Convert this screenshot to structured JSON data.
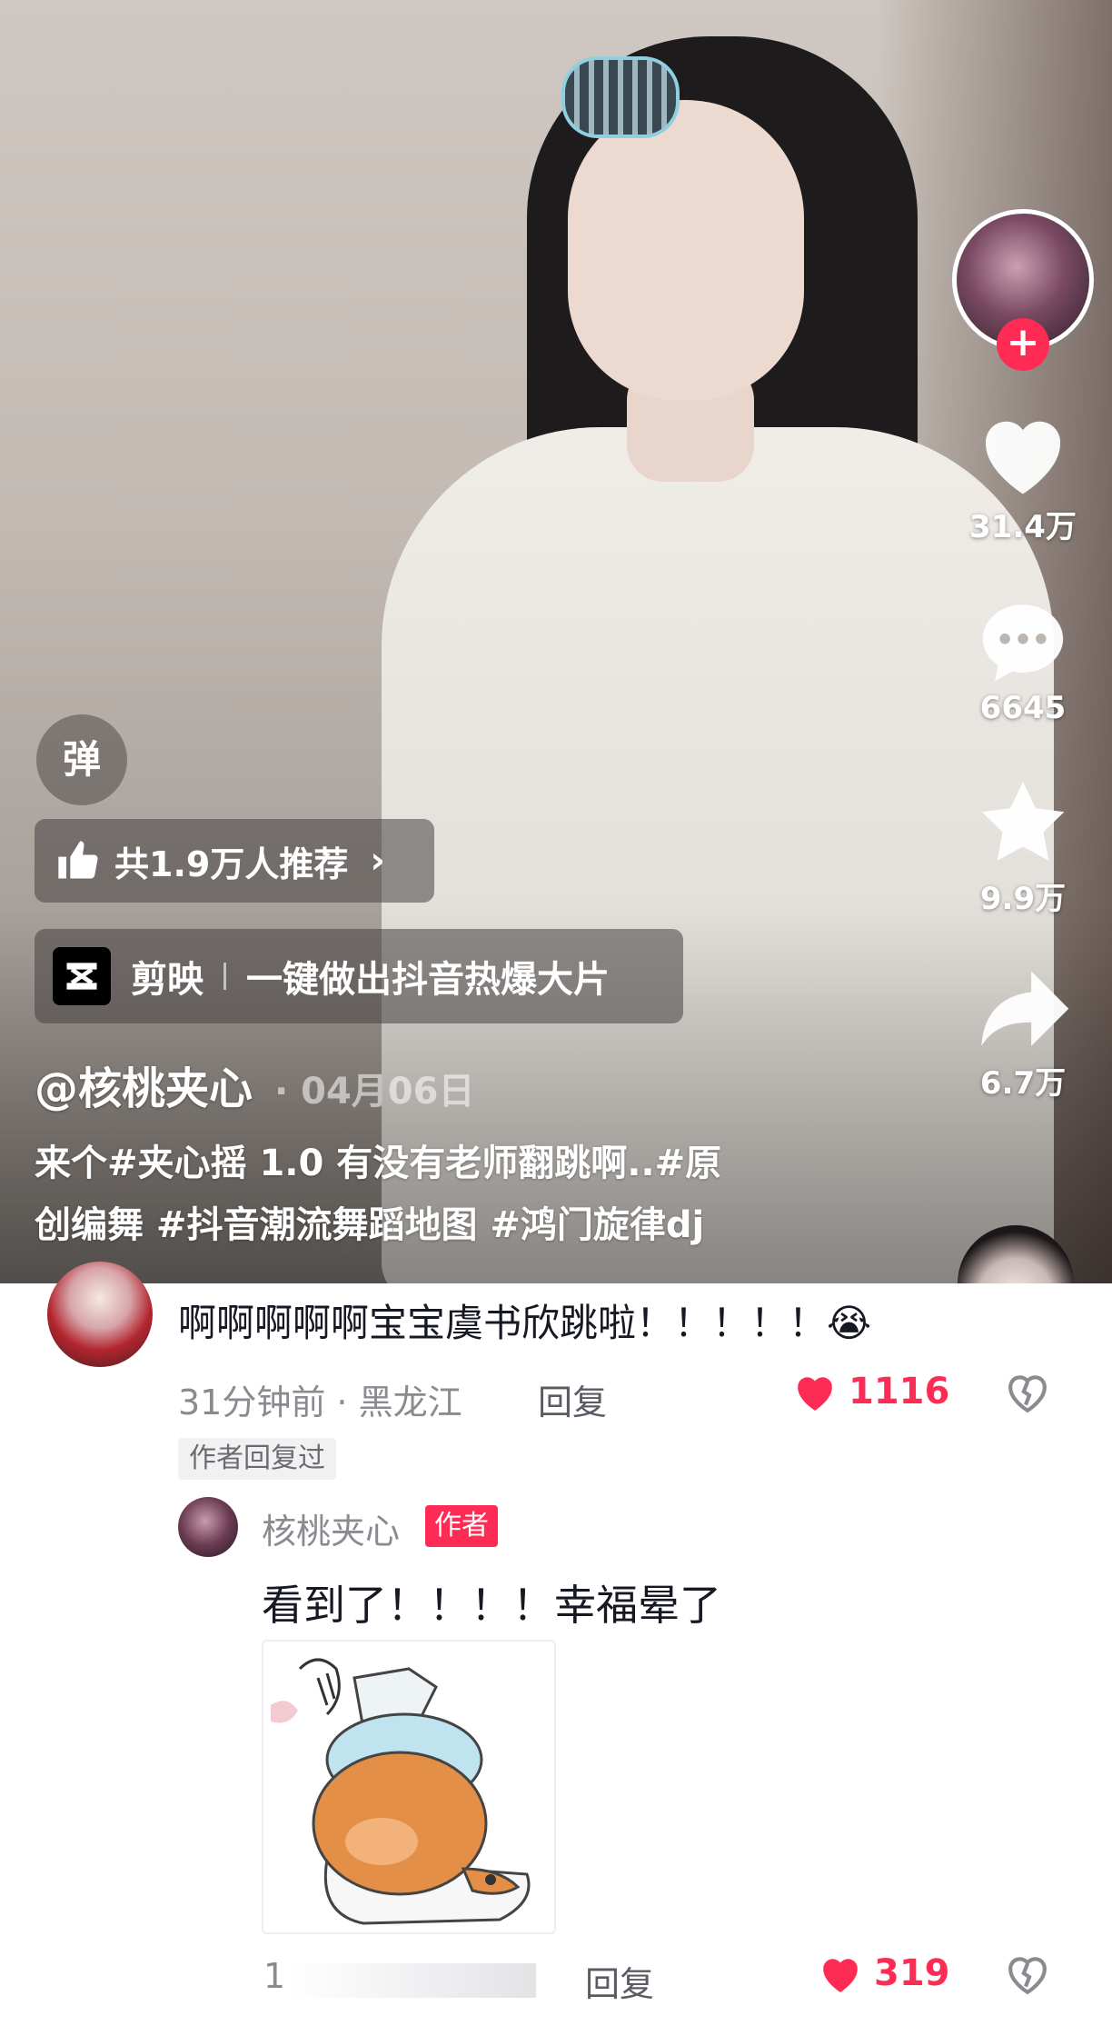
{
  "video": {
    "danmu_label": "弹",
    "recommend_label": "共1.9万人推荐",
    "recommend_chevron": "›",
    "ad": {
      "name": "剪映",
      "slogan": "一键做出抖音热爆大片"
    },
    "author": "@核桃夹心",
    "date": "· 04月06日",
    "caption_line1": "来个#夹心摇 1.0 有没有老师翻跳啊..#原",
    "caption_line2": "创编舞 #抖音潮流舞蹈地图 #鸿门旋律dj"
  },
  "rail": {
    "follow_symbol": "+",
    "likes": "31.4万",
    "comments": "6645",
    "favorites": "9.9万",
    "shares": "6.7万"
  },
  "comment": {
    "text": "啊啊啊啊啊宝宝虞书欣跳啦！！！！！😭",
    "meta": "31分钟前 · 黑龙江",
    "reply_label": "回复",
    "like_count": "1116",
    "author_replied_tag": "作者回复过",
    "reply": {
      "name": "核桃夹心",
      "badge": "作者",
      "text": "看到了！！！！幸福晕了",
      "time": "1",
      "reply_label": "回复",
      "like_count": "319"
    }
  },
  "colors": {
    "accent": "#fe2c55",
    "text_primary": "#161823",
    "text_secondary": "#8a8b91"
  },
  "icons": [
    "thumbs-up-icon",
    "heart-icon",
    "comment-bubble-icon",
    "star-icon",
    "share-arrow-icon",
    "jianying-logo-icon",
    "broken-heart-icon"
  ]
}
